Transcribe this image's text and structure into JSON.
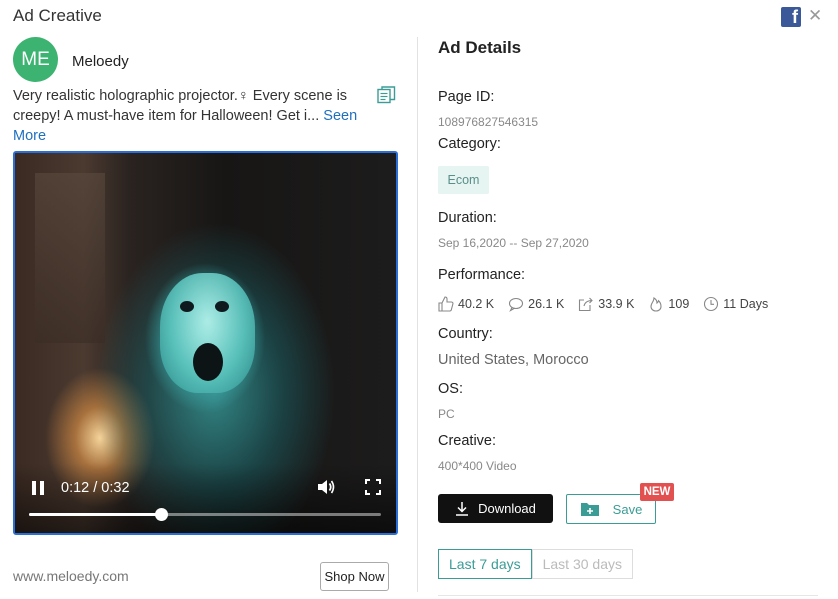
{
  "header": {
    "title": "Ad Creative",
    "facebook_icon": "facebook-icon",
    "close_icon": "close-icon"
  },
  "advertiser": {
    "avatar_initials": "ME",
    "avatar_color": "#3cb371",
    "name": "Meloedy"
  },
  "ad": {
    "text": "Very realistic holographic projector.♀ Every scene is creepy! A must-have item for Halloween! Get i...",
    "see_more_label": "Seen More"
  },
  "video": {
    "current_time": "0:12",
    "duration": "0:32",
    "time_display": "0:12 / 0:32",
    "progress_fraction": 0.375,
    "accent_color": "#2a6fd8"
  },
  "footer": {
    "website": "www.meloedy.com",
    "cta_label": "Shop Now"
  },
  "details": {
    "title": "Ad Details",
    "page_id_label": "Page ID:",
    "page_id": "108976827546315",
    "category_label": "Category:",
    "category": "Ecom",
    "duration_label": "Duration:",
    "duration": "Sep 16,2020 -- Sep 27,2020",
    "performance_label": "Performance:",
    "performance": {
      "likes": "40.2 K",
      "comments": "26.1 K",
      "shares": "33.9 K",
      "popularity": "109",
      "days": "11 Days"
    },
    "country_label": "Country:",
    "country": "United States, Morocco",
    "os_label": "OS:",
    "os": "PC",
    "creative_label": "Creative:",
    "creative": "400*400 Video"
  },
  "actions": {
    "download_label": "Download",
    "save_label": "Save",
    "new_badge": "NEW",
    "accent_color": "#3b9c96",
    "badge_color": "#e25050"
  },
  "range_tabs": [
    {
      "label": "Last 7 days",
      "active": true
    },
    {
      "label": "Last 30 days",
      "active": false
    }
  ]
}
